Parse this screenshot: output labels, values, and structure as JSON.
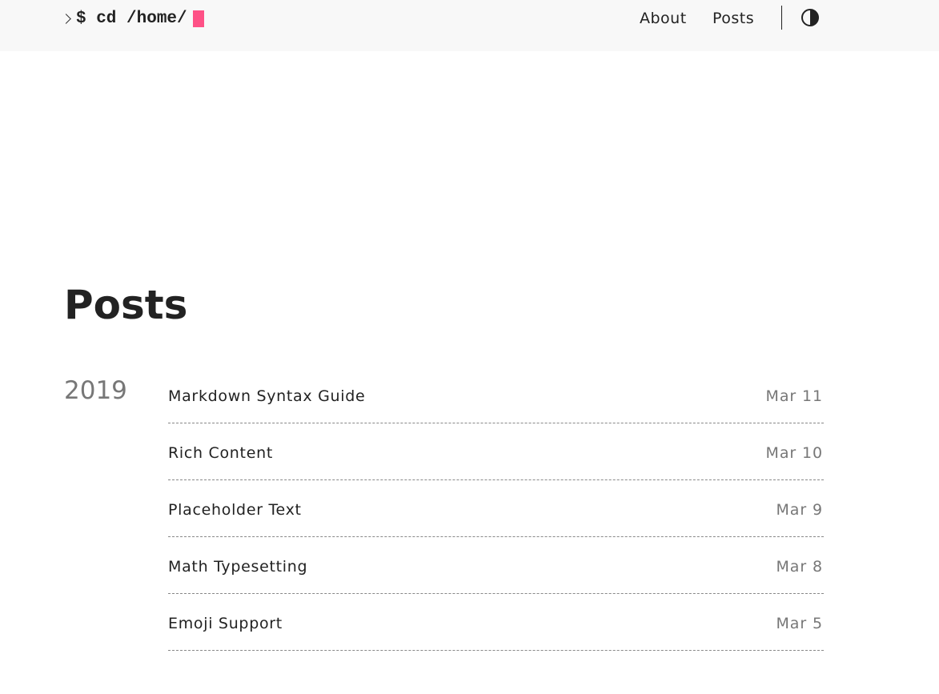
{
  "header": {
    "logo_command": "$ cd /home/",
    "nav": [
      {
        "label": "About"
      },
      {
        "label": "Posts"
      }
    ],
    "theme_toggle_icon": "contrast-icon"
  },
  "main": {
    "title": "Posts",
    "year": "2019",
    "posts": [
      {
        "title": "Markdown Syntax Guide",
        "date": "Mar 11"
      },
      {
        "title": "Rich Content",
        "date": "Mar 10"
      },
      {
        "title": "Placeholder Text",
        "date": "Mar 9"
      },
      {
        "title": "Math Typesetting",
        "date": "Mar 8"
      },
      {
        "title": "Emoji Support",
        "date": "Mar 5"
      }
    ]
  },
  "colors": {
    "cursor": "#fe5186",
    "header_bg": "#f8f8f8",
    "muted_text": "#777777"
  }
}
